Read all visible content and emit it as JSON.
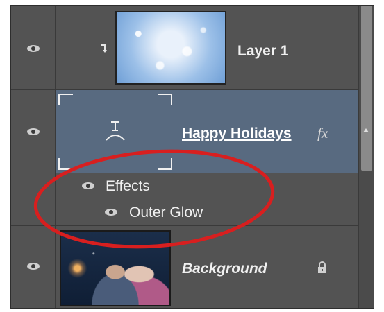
{
  "layers": {
    "layer1": {
      "name": "Layer 1"
    },
    "text_layer": {
      "name": "Happy Holidays",
      "fx": "fx"
    },
    "effects": {
      "label": "Effects"
    },
    "outer_glow": {
      "label": "Outer Glow"
    },
    "background": {
      "name": "Background"
    }
  },
  "colors": {
    "panel": "#535353",
    "selected_row": "#586a80",
    "annotation_ellipse": "#d81f1f"
  },
  "icons": [
    "eye-icon",
    "clipping-arrow-icon",
    "text-layer-icon",
    "fx-icon",
    "lock-icon"
  ]
}
